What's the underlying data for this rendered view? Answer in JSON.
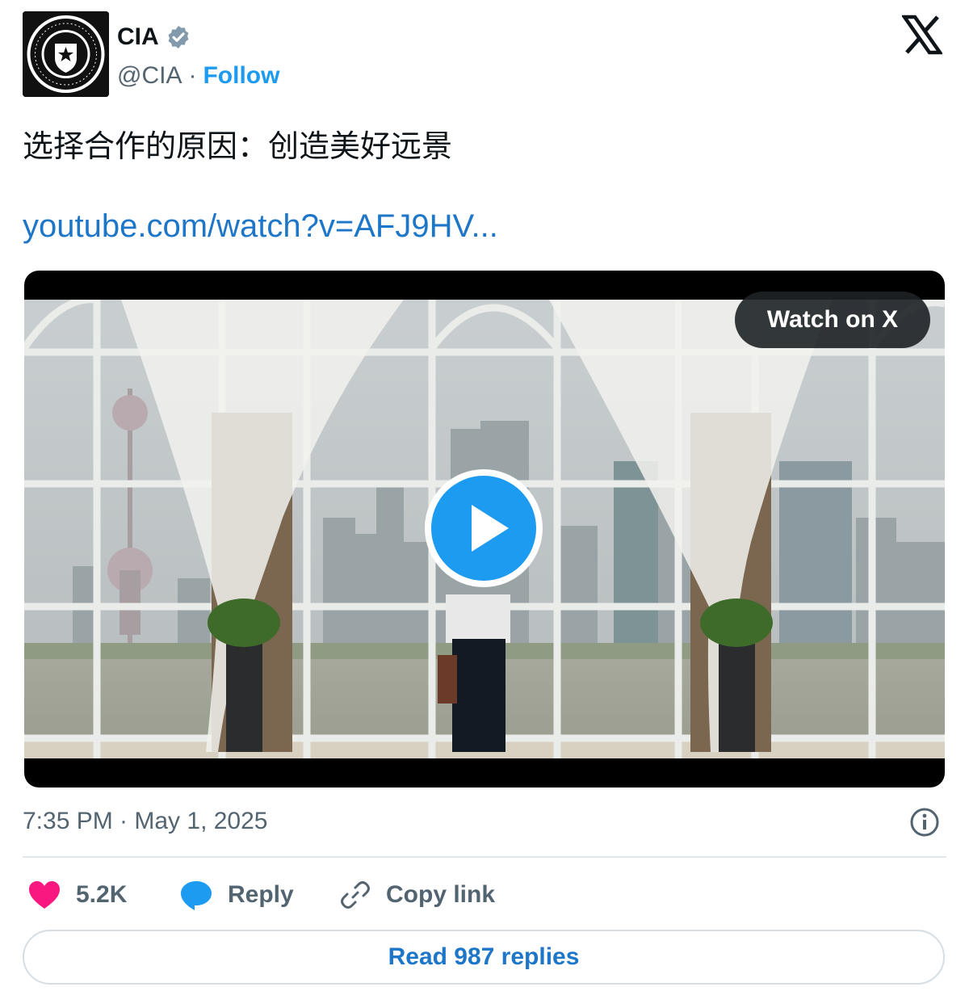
{
  "author": {
    "display_name": "CIA",
    "handle": "@CIA",
    "separator": "·",
    "follow_label": "Follow",
    "verified": true
  },
  "tweet": {
    "text": "选择合作的原因：创造美好远景",
    "link": "youtube.com/watch?v=AFJ9HV..."
  },
  "video": {
    "watch_label": "Watch on X"
  },
  "timestamp": "7:35 PM · May 1, 2025",
  "actions": {
    "likes": "5.2K",
    "reply_label": "Reply",
    "copy_label": "Copy link"
  },
  "read_replies_label": "Read 987 replies",
  "colors": {
    "accent": "#1d9bf0",
    "like": "#f91880",
    "link": "#1d76c8"
  },
  "icons": [
    "cia-seal-icon",
    "verified-badge-icon",
    "x-logo-icon",
    "play-icon",
    "info-icon",
    "heart-icon",
    "reply-bubble-icon",
    "link-icon"
  ]
}
